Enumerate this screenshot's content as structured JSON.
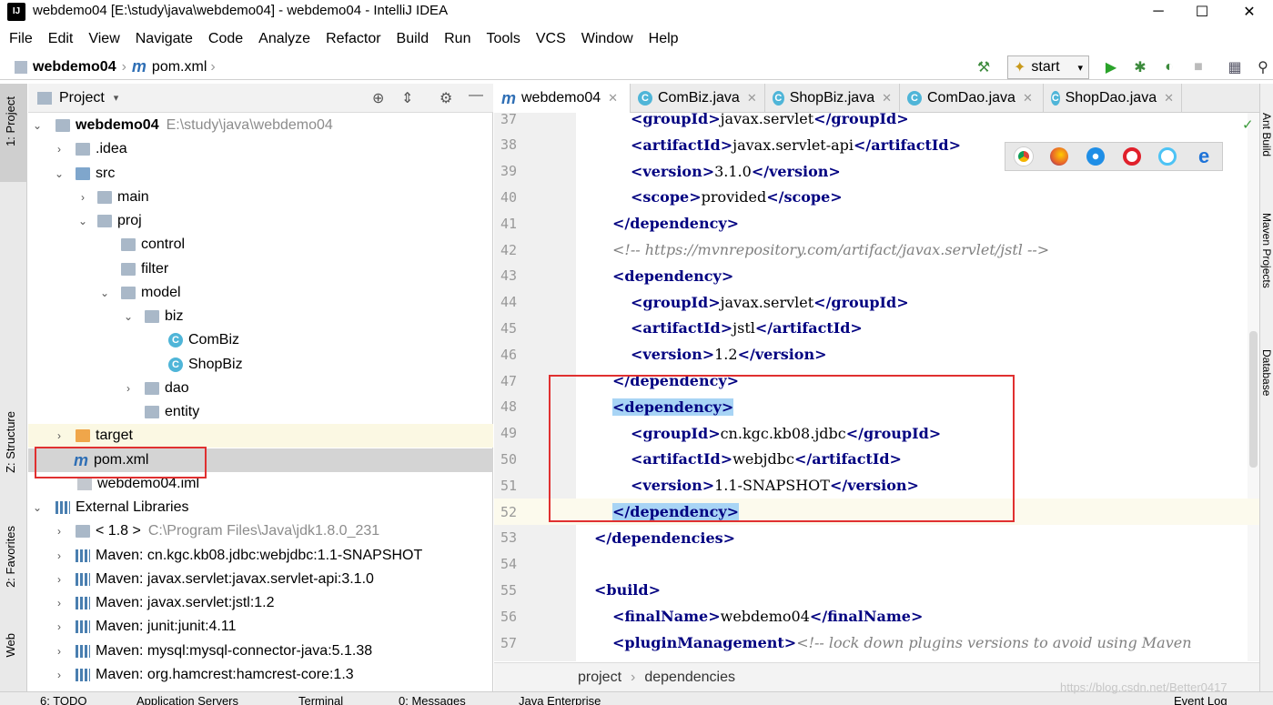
{
  "window": {
    "title": "webdemo04 [E:\\study\\java\\webdemo04] - webdemo04 - IntelliJ IDEA",
    "logo": "IJ",
    "minimize": "─",
    "maximize": "☐",
    "close": "✕"
  },
  "menu": [
    "File",
    "Edit",
    "View",
    "Navigate",
    "Code",
    "Analyze",
    "Refactor",
    "Build",
    "Run",
    "Tools",
    "VCS",
    "Window",
    "Help"
  ],
  "navbar": {
    "project": "webdemo04",
    "file": "pom.xml",
    "run_config": "start"
  },
  "left_tabs": {
    "project": "1: Project",
    "structure": "Z: Structure",
    "favorites": "2: Favorites",
    "web": "Web"
  },
  "right_tabs": {
    "ant": "Ant Build",
    "maven": "Maven Projects",
    "database": "Database"
  },
  "project_panel": {
    "title": "Project",
    "tree": [
      {
        "label": "webdemo04",
        "detail": "E:\\study\\java\\webdemo04"
      },
      {
        "label": ".idea"
      },
      {
        "label": "src"
      },
      {
        "label": "main"
      },
      {
        "label": "proj"
      },
      {
        "label": "control"
      },
      {
        "label": "filter"
      },
      {
        "label": "model"
      },
      {
        "label": "biz"
      },
      {
        "label": "ComBiz"
      },
      {
        "label": "ShopBiz"
      },
      {
        "label": "dao"
      },
      {
        "label": "entity"
      },
      {
        "label": "target"
      },
      {
        "label": "pom.xml"
      },
      {
        "label": "webdemo04.iml"
      },
      {
        "label": "External Libraries"
      },
      {
        "label": "< 1.8 >",
        "detail": "C:\\Program Files\\Java\\jdk1.8.0_231"
      },
      {
        "label": "Maven: cn.kgc.kb08.jdbc:webjdbc:1.1-SNAPSHOT"
      },
      {
        "label": "Maven: javax.servlet:javax.servlet-api:3.1.0"
      },
      {
        "label": "Maven: javax.servlet:jstl:1.2"
      },
      {
        "label": "Maven: junit:junit:4.11"
      },
      {
        "label": "Maven: mysql:mysql-connector-java:5.1.38"
      },
      {
        "label": "Maven: org.hamcrest:hamcrest-core:1.3"
      }
    ]
  },
  "editor_tabs": [
    "webdemo04",
    "ComBiz.java",
    "ShopBiz.java",
    "ComDao.java",
    "ShopDao.java"
  ],
  "code": {
    "lines": [
      {
        "n": "37",
        "parts": [
          [
            "tag",
            "<groupId>"
          ],
          [
            "txt",
            "javax.servlet"
          ],
          [
            "tag",
            "</groupId>"
          ]
        ]
      },
      {
        "n": "38",
        "parts": [
          [
            "tag",
            "<artifactId>"
          ],
          [
            "txt",
            "javax.servlet-api"
          ],
          [
            "tag",
            "</artifactId>"
          ]
        ]
      },
      {
        "n": "39",
        "parts": [
          [
            "tag",
            "<version>"
          ],
          [
            "txt",
            "3.1.0"
          ],
          [
            "tag",
            "</version>"
          ]
        ]
      },
      {
        "n": "40",
        "parts": [
          [
            "tag",
            "<scope>"
          ],
          [
            "txt",
            "provided"
          ],
          [
            "tag",
            "</scope>"
          ]
        ]
      },
      {
        "n": "41",
        "parts": [
          [
            "tag",
            "</dependency>"
          ]
        ]
      },
      {
        "n": "42",
        "parts": [
          [
            "cmt",
            "<!-- https://mvnrepository.com/artifact/javax.servlet/jstl -->"
          ]
        ]
      },
      {
        "n": "43",
        "parts": [
          [
            "tag",
            "<dependency>"
          ]
        ]
      },
      {
        "n": "44",
        "parts": [
          [
            "tag",
            "<groupId>"
          ],
          [
            "txt",
            "javax.servlet"
          ],
          [
            "tag",
            "</groupId>"
          ]
        ]
      },
      {
        "n": "45",
        "parts": [
          [
            "tag",
            "<artifactId>"
          ],
          [
            "txt",
            "jstl"
          ],
          [
            "tag",
            "</artifactId>"
          ]
        ]
      },
      {
        "n": "46",
        "parts": [
          [
            "tag",
            "<version>"
          ],
          [
            "txt",
            "1.2"
          ],
          [
            "tag",
            "</version>"
          ]
        ]
      },
      {
        "n": "47",
        "parts": [
          [
            "tag",
            "</dependency>"
          ]
        ]
      },
      {
        "n": "48",
        "parts": [
          [
            "tag",
            "<dependency>"
          ]
        ]
      },
      {
        "n": "49",
        "parts": [
          [
            "tag",
            "<groupId>"
          ],
          [
            "txt",
            "cn.kgc.kb08.jdbc"
          ],
          [
            "tag",
            "</groupId>"
          ]
        ]
      },
      {
        "n": "50",
        "parts": [
          [
            "tag",
            "<artifactId>"
          ],
          [
            "txt",
            "webjdbc"
          ],
          [
            "tag",
            "</artifactId>"
          ]
        ]
      },
      {
        "n": "51",
        "parts": [
          [
            "tag",
            "<version>"
          ],
          [
            "txt",
            "1.1-SNAPSHOT"
          ],
          [
            "tag",
            "</version>"
          ]
        ]
      },
      {
        "n": "52",
        "parts": [
          [
            "tag",
            "</dependency>"
          ]
        ]
      },
      {
        "n": "53",
        "parts": [
          [
            "tag",
            "</dependencies>"
          ]
        ]
      },
      {
        "n": "54",
        "parts": []
      },
      {
        "n": "55",
        "parts": [
          [
            "tag",
            "<build>"
          ]
        ]
      },
      {
        "n": "56",
        "parts": [
          [
            "tag",
            "<finalName>"
          ],
          [
            "txt",
            "webdemo04"
          ],
          [
            "tag",
            "</finalName>"
          ]
        ]
      },
      {
        "n": "57",
        "parts": [
          [
            "tag",
            "<pluginManagement>"
          ],
          [
            "cmt",
            "<!-- lock down plugins versions to avoid using Maven"
          ]
        ]
      }
    ]
  },
  "editor_breadcrumb": {
    "a": "project",
    "b": "dependencies"
  },
  "bottom_tabs": [
    "6: TODO",
    "Application Servers",
    "Terminal",
    "0: Messages",
    "Java Enterprise",
    "Event Log"
  ],
  "watermark": "https://blog.csdn.net/Better0417"
}
